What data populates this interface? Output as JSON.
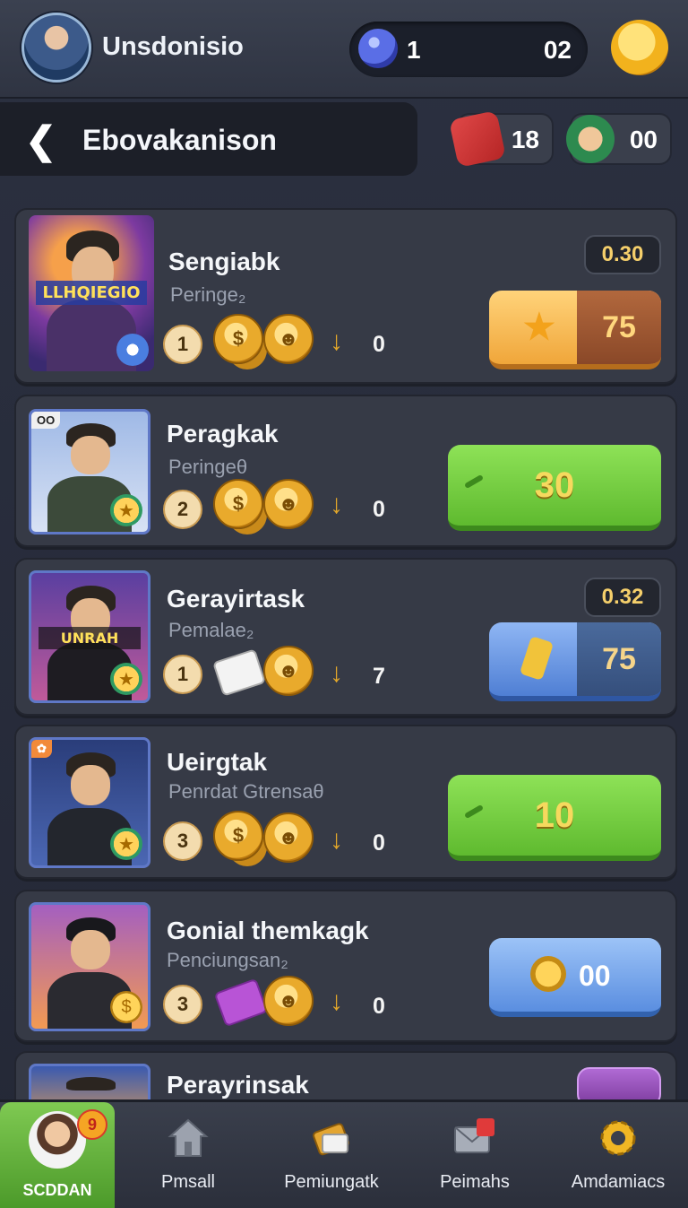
{
  "topbar": {
    "username": "Unsdonisio",
    "currency_left": "1",
    "currency_right": "02"
  },
  "header": {
    "title": "Ebovakanison",
    "resource_1": "18",
    "resource_2": "00"
  },
  "cards": [
    {
      "title": "Sengiabk",
      "subtitle": "Peringe₂",
      "rank": "1",
      "reward_count": "0",
      "timer": "0.30",
      "button_value": "75",
      "thumb_text": "LLHQIEGIO"
    },
    {
      "title": "Peragkak",
      "subtitle": "Peringeθ",
      "rank": "2",
      "reward_count": "0",
      "button_value": "30",
      "thumb_tag": "OO"
    },
    {
      "title": "Gerayirtask",
      "subtitle": "Pemalae₂",
      "rank": "1",
      "reward_count": "7",
      "timer": "0.32",
      "button_value": "75",
      "thumb_text": "UNRAH"
    },
    {
      "title": "Ueirgtak",
      "subtitle": "Penrdat Gtrensaθ",
      "rank": "3",
      "reward_count": "0",
      "button_value": "10"
    },
    {
      "title": "Gonial themkagk",
      "subtitle": "Penciungsan₂",
      "rank": "3",
      "reward_count": "0",
      "button_value": "00"
    },
    {
      "title": "Perayrinsak"
    }
  ],
  "nav": {
    "items": [
      {
        "label": "SCDDAN",
        "badge": "9"
      },
      {
        "label": "Pmsall"
      },
      {
        "label": "Pemiungatk"
      },
      {
        "label": "Peimahs"
      },
      {
        "label": "Amdamiacs"
      }
    ]
  },
  "colors": {
    "background": "#2b3040",
    "card": "#363a46",
    "green_button": "#6cc83a",
    "orange_button": "#f0a63a",
    "blue_button": "#4f7fd4",
    "gold": "#e9aa2c"
  },
  "icons": [
    "avatar",
    "gem-icon",
    "gold-coin-icon",
    "back-icon",
    "chest-icon",
    "character-icon",
    "coin-icon",
    "arrow-down-icon",
    "star-icon",
    "home-icon",
    "gift-icon",
    "mail-icon",
    "gear-icon"
  ]
}
